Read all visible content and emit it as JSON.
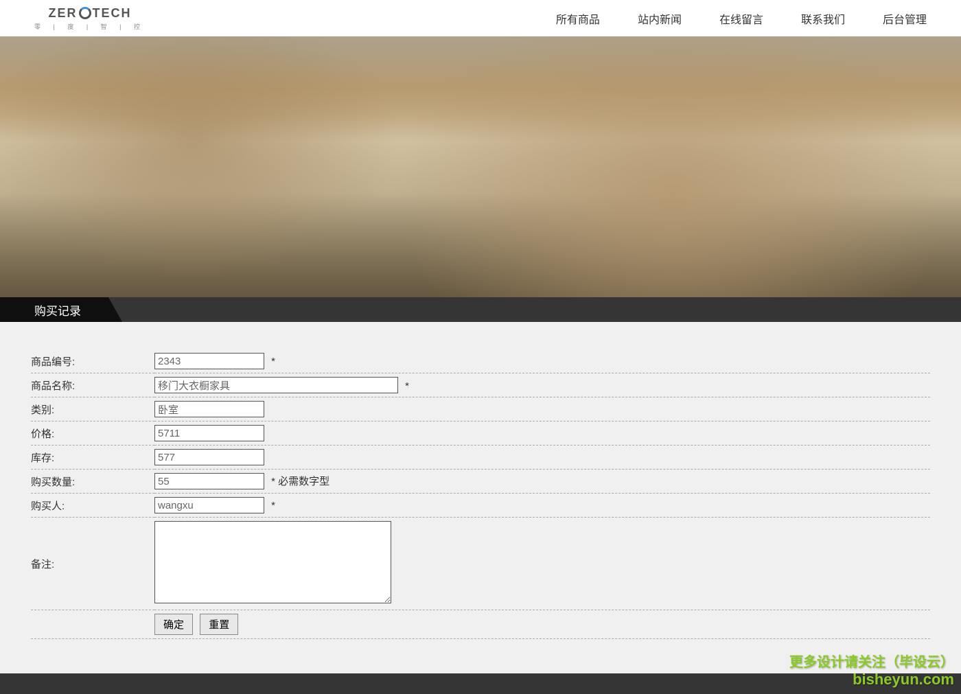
{
  "logo": {
    "text1": "ZER",
    "text2": "TECH",
    "sub": "零 | 度 | 智 | 控"
  },
  "nav": {
    "items": [
      {
        "label": "所有商品"
      },
      {
        "label": "站内新闻"
      },
      {
        "label": "在线留言"
      },
      {
        "label": "联系我们"
      },
      {
        "label": "后台管理"
      }
    ]
  },
  "page_title": "购买记录",
  "form": {
    "product_id": {
      "label": "商品编号:",
      "value": "2343",
      "note": "*"
    },
    "product_name": {
      "label": "商品名称:",
      "value": "移门大衣橱家具",
      "note": "*"
    },
    "category": {
      "label": "类别:",
      "value": "卧室"
    },
    "price": {
      "label": "价格:",
      "value": "5711"
    },
    "stock": {
      "label": "库存:",
      "value": "577"
    },
    "quantity": {
      "label": "购买数量:",
      "value": "55",
      "note": "* 必需数字型"
    },
    "buyer": {
      "label": "购买人:",
      "value": "wangxu",
      "note": "*"
    },
    "remark": {
      "label": "备注:",
      "value": ""
    }
  },
  "buttons": {
    "ok": "确定",
    "reset": "重置"
  },
  "watermark": {
    "line1": "更多设计请关注（毕设云）",
    "line2": "bisheyun.com"
  }
}
